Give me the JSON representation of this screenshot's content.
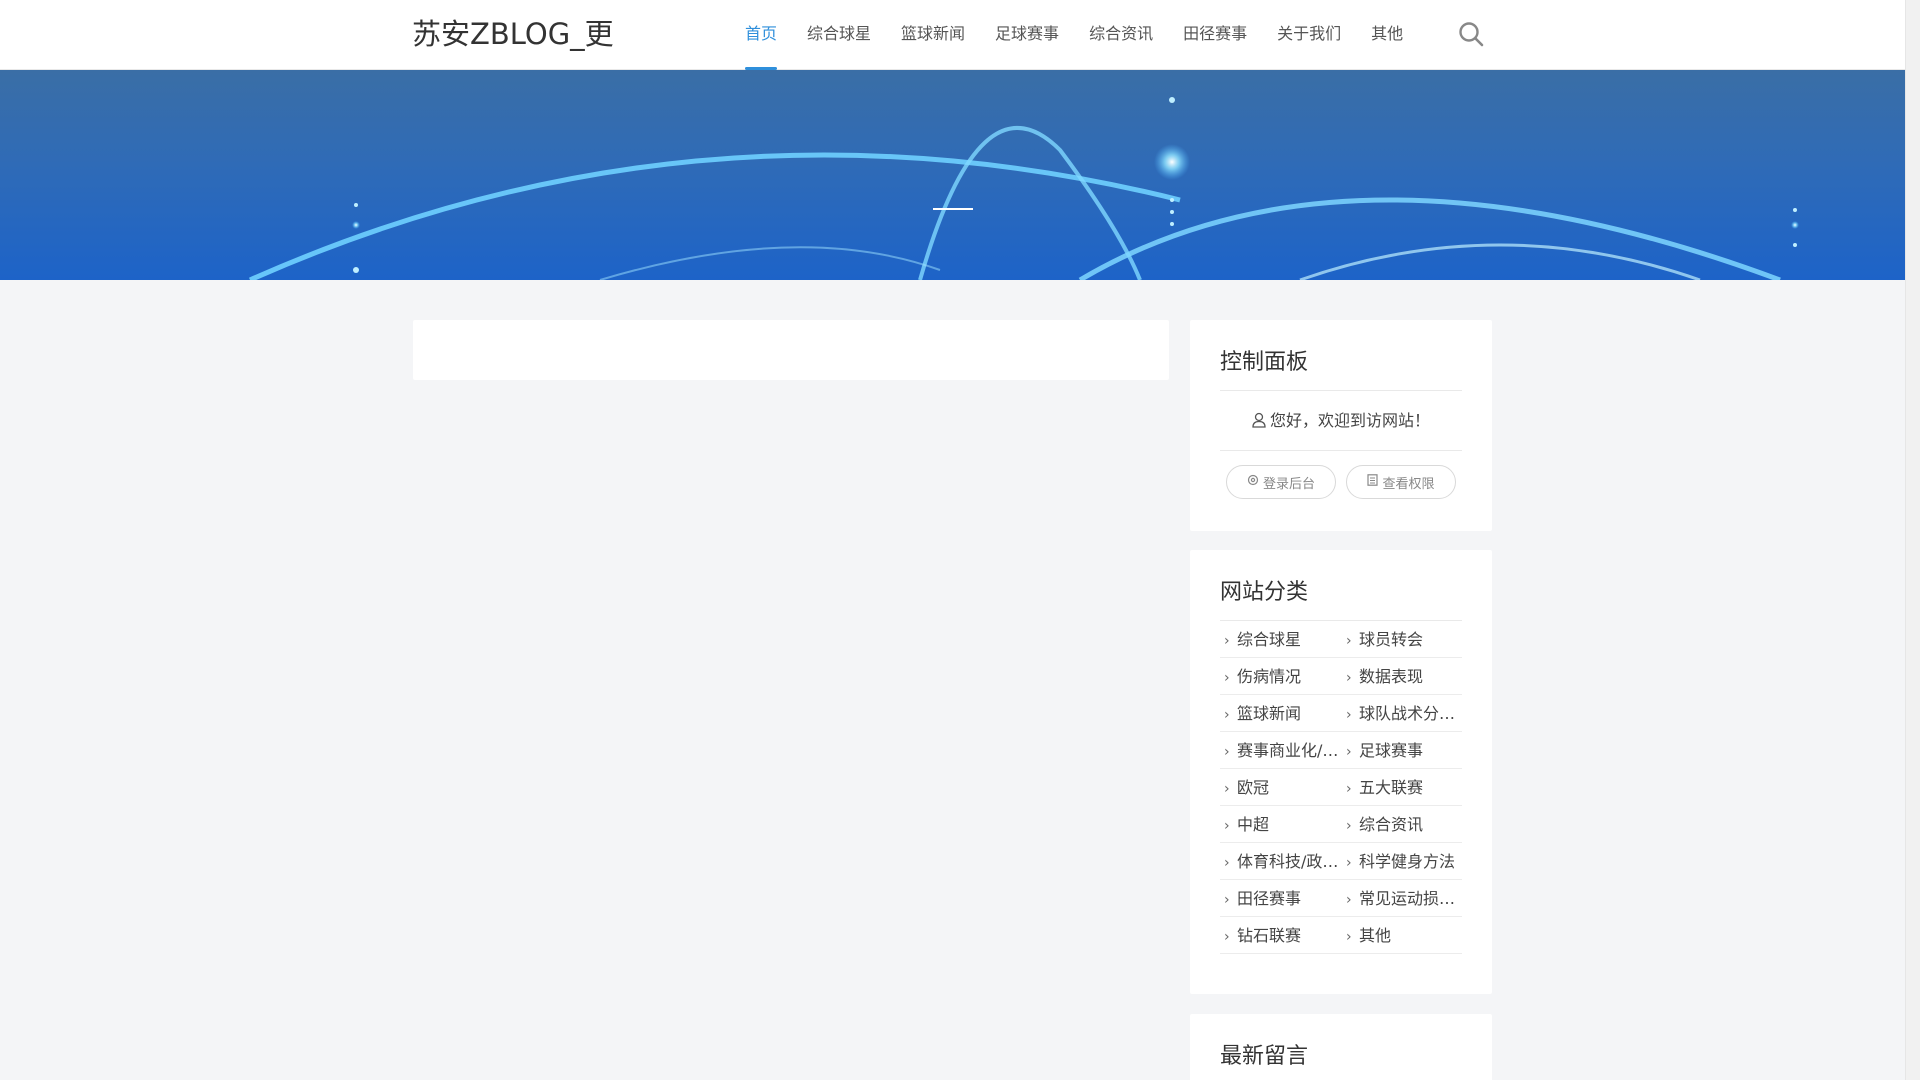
{
  "header": {
    "site_title": "苏安ZBLOG_更",
    "nav": [
      {
        "label": "首页",
        "active": true
      },
      {
        "label": "综合球星"
      },
      {
        "label": "篮球新闻"
      },
      {
        "label": "足球赛事"
      },
      {
        "label": "综合资讯"
      },
      {
        "label": "田径赛事"
      },
      {
        "label": "关于我们"
      },
      {
        "label": "其他"
      }
    ],
    "search_icon": "search-icon",
    "accent_color": "#2f8fdb"
  },
  "sidebar": {
    "panel": {
      "title": "控制面板",
      "welcome": "您好，欢迎到访网站！",
      "login_label": "登录后台",
      "permission_label": "查看权限"
    },
    "categories": {
      "title": "网站分类",
      "items": [
        "综合球星",
        "球员转会",
        "伤病情况",
        "数据表现",
        "篮球新闻",
        "球队战术分…",
        "赛事商业化/…",
        "足球赛事",
        "欧冠",
        "五大联赛",
        "中超",
        "综合资讯",
        "体育科技/政…",
        "科学健身方法",
        "田径赛事",
        "常见运动损…",
        "钻石联赛",
        "其他"
      ]
    },
    "comments": {
      "title": "最新留言"
    }
  }
}
